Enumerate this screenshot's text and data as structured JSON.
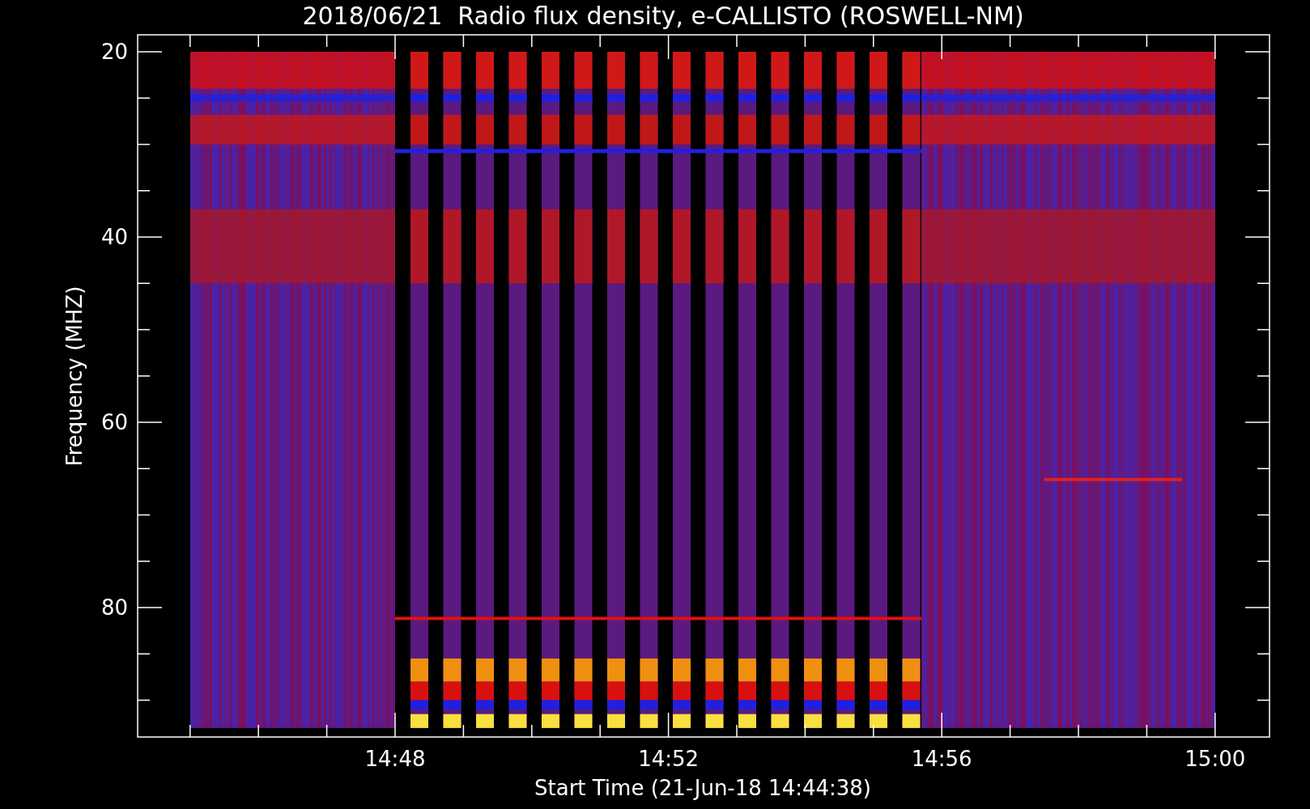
{
  "title": "2018/06/21  Radio flux density, e-CALLISTO (ROSWELL-NM)",
  "y_axis": {
    "label": "Frequency (MHZ)",
    "ticks": [
      "20",
      "40",
      "60",
      "80"
    ]
  },
  "x_axis": {
    "label": "Start Time (21-Jun-18 14:44:38)",
    "ticks": [
      "14:48",
      "14:52",
      "14:56",
      "15:00"
    ]
  }
}
